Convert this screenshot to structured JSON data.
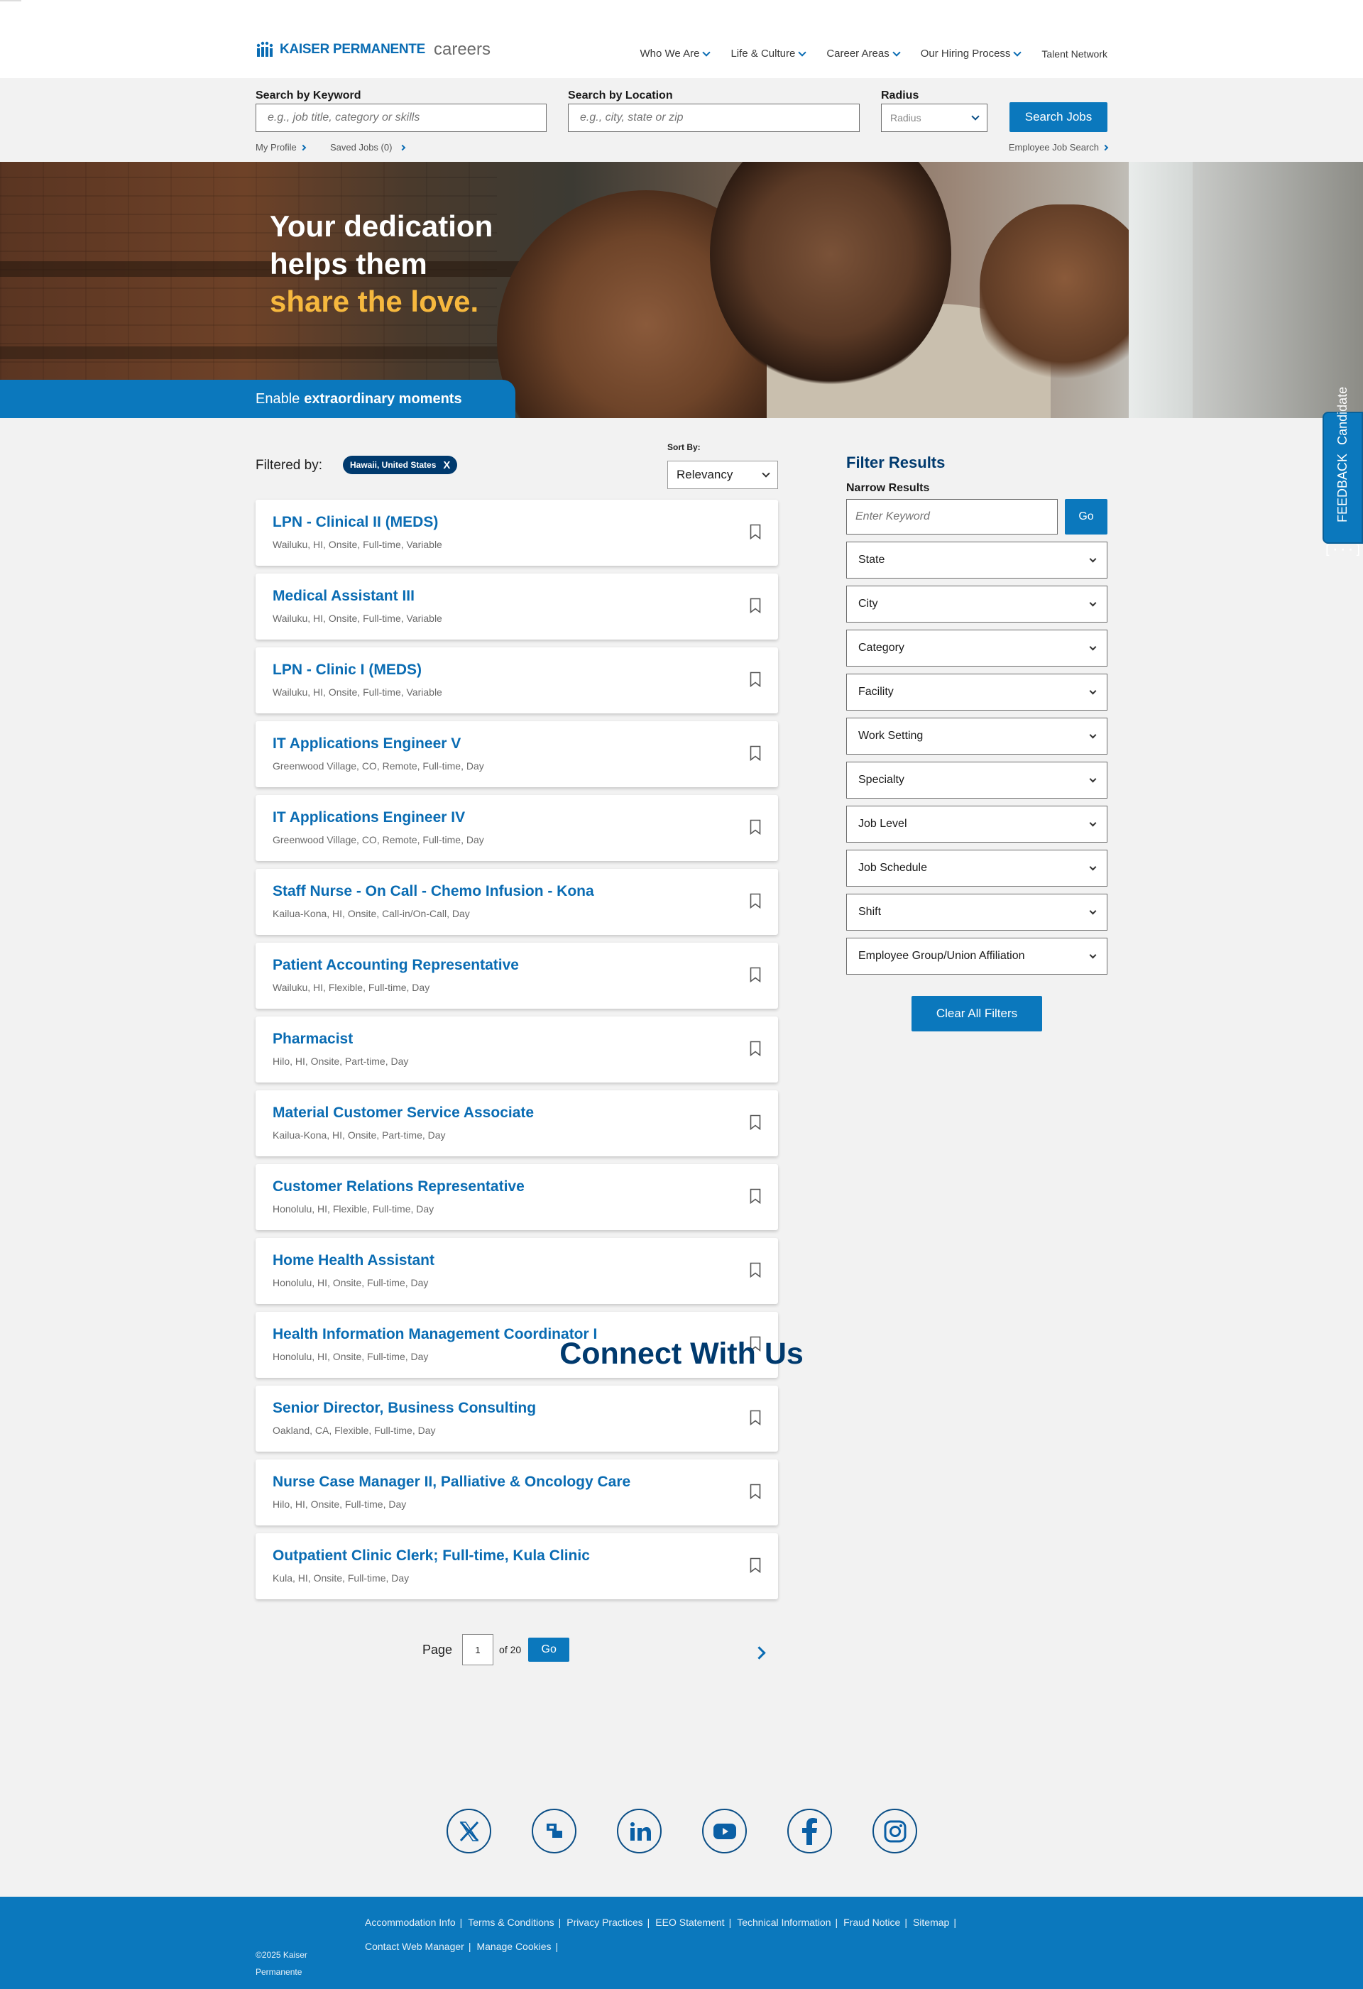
{
  "header": {
    "logo_text": "KAISER PERMANENTE",
    "logo_suffix": "careers",
    "nav": [
      {
        "label": "Who We Are",
        "has_dropdown": true
      },
      {
        "label": "Life & Culture",
        "has_dropdown": true
      },
      {
        "label": "Career Areas",
        "has_dropdown": true
      },
      {
        "label": "Our Hiring Process",
        "has_dropdown": true
      },
      {
        "label": "Talent Network",
        "has_dropdown": false
      }
    ]
  },
  "search": {
    "keyword_label": "Search by Keyword",
    "keyword_placeholder": "e.g., job title, category or skills",
    "location_label": "Search by Location",
    "location_placeholder": "e.g., city, state or zip",
    "radius_label": "Radius",
    "radius_value": "Radius",
    "button": "Search Jobs",
    "my_profile": "My Profile",
    "saved_jobs": "Saved Jobs (0)",
    "employee_search": "Employee Job Search"
  },
  "hero": {
    "line1": "Your dedication",
    "line2": "helps them",
    "line3": "share the love.",
    "banner_prefix": "Enable",
    "banner_bold": "extraordinary moments"
  },
  "feedback": {
    "line1": "Candidate",
    "line2": "FEEDBACK",
    "icon": "[···]"
  },
  "results": {
    "filtered_by": "Filtered by:",
    "chip": "Hawaii, United States",
    "chip_close": "X",
    "sort_label": "Sort By:",
    "sort_value": "Relevancy",
    "jobs": [
      {
        "title": "LPN - Clinical II (MEDS)",
        "meta": "Wailuku, HI, Onsite, Full-time, Variable"
      },
      {
        "title": "Medical Assistant III",
        "meta": "Wailuku, HI, Onsite, Full-time, Variable"
      },
      {
        "title": "LPN - Clinic I (MEDS)",
        "meta": "Wailuku, HI, Onsite, Full-time, Variable"
      },
      {
        "title": "IT Applications Engineer V",
        "meta": "Greenwood Village, CO, Remote, Full-time, Day"
      },
      {
        "title": "IT Applications Engineer IV",
        "meta": "Greenwood Village, CO, Remote, Full-time, Day"
      },
      {
        "title": "Staff Nurse - On Call - Chemo Infusion - Kona",
        "meta": "Kailua-Kona, HI, Onsite, Call-in/On-Call, Day"
      },
      {
        "title": "Patient Accounting Representative",
        "meta": "Wailuku, HI, Flexible, Full-time, Day"
      },
      {
        "title": "Pharmacist",
        "meta": "Hilo, HI, Onsite, Part-time, Day"
      },
      {
        "title": "Material Customer Service Associate",
        "meta": "Kailua-Kona, HI, Onsite, Part-time, Day"
      },
      {
        "title": "Customer Relations Representative",
        "meta": "Honolulu, HI, Flexible, Full-time, Day"
      },
      {
        "title": "Home Health Assistant",
        "meta": "Honolulu, HI, Onsite, Full-time, Day"
      },
      {
        "title": "Health Information Management Coordinator I",
        "meta": "Honolulu, HI, Onsite, Full-time, Day"
      },
      {
        "title": "Senior Director, Business Consulting",
        "meta": "Oakland, CA, Flexible, Full-time, Day"
      },
      {
        "title": "Nurse Case Manager II, Palliative & Oncology Care",
        "meta": "Hilo, HI, Onsite, Full-time, Day"
      },
      {
        "title": "Outpatient Clinic Clerk; Full-time, Kula Clinic",
        "meta": "Kula, HI, Onsite, Full-time, Day"
      }
    ],
    "pager": {
      "page_label": "Page",
      "current": "1",
      "of": "of 20",
      "go": "Go"
    }
  },
  "filters": {
    "title": "Filter Results",
    "narrow": "Narrow Results",
    "keyword_placeholder": "Enter Keyword",
    "go": "Go",
    "selects": [
      "State",
      "City",
      "Category",
      "Facility",
      "Work Setting",
      "Specialty",
      "Job Level",
      "Job Schedule",
      "Shift",
      "Employee Group/Union Affiliation"
    ],
    "clear": "Clear All Filters"
  },
  "connect": {
    "title": "Connect With Us",
    "icons": [
      "x-icon",
      "glassdoor-icon",
      "linkedin-icon",
      "youtube-icon",
      "facebook-icon",
      "instagram-icon"
    ]
  },
  "footer": {
    "copyright_line1": "©2025 Kaiser",
    "copyright_line2": "Permanente",
    "links_row1": [
      "Accommodation Info",
      "Terms & Conditions",
      "Privacy Practices",
      "EEO Statement",
      "Technical Information",
      "Fraud Notice",
      "Sitemap"
    ],
    "links_row2": [
      "Contact Web Manager",
      "Manage Cookies"
    ]
  },
  "colors": {
    "brand_blue": "#0b78bd",
    "navy": "#003a6e",
    "hero_accent": "#f6b83e"
  }
}
